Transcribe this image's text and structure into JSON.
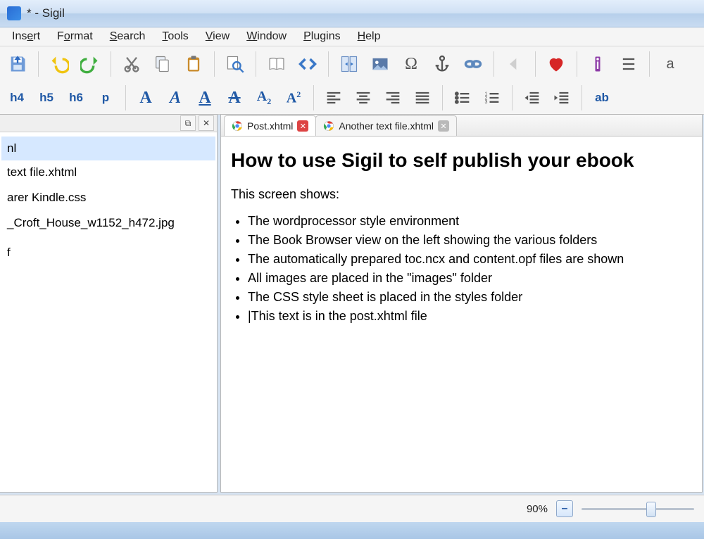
{
  "window": {
    "title": "* - Sigil"
  },
  "menu": {
    "insert": {
      "label": "Insert",
      "u": 4
    },
    "format": {
      "label": "Format",
      "u": 1
    },
    "search": {
      "label": "Search",
      "u": 0
    },
    "tools": {
      "label": "Tools",
      "u": 0
    },
    "view": {
      "label": "View",
      "u": 0
    },
    "window": {
      "label": "Window",
      "u": 0
    },
    "plugins": {
      "label": "Plugins",
      "u": 0
    },
    "help": {
      "label": "Help",
      "u": 0
    }
  },
  "toolbar1": {
    "save": "save-icon",
    "undo": "undo-icon",
    "redo": "redo-icon",
    "cut": "cut-icon",
    "copy": "copy-icon",
    "paste": "paste-icon",
    "find": "find-icon",
    "bookview": "book-icon",
    "codeview": "code-icon",
    "split": "split-icon",
    "insert_image": "image-icon",
    "special_char": "omega-icon",
    "anchor": "anchor-icon",
    "link": "link-icon",
    "back": "back-icon",
    "favorite": "heart-icon",
    "metadata": "info-icon",
    "toc": "toc-icon"
  },
  "toolbar2": {
    "headings": [
      "h4",
      "h5",
      "h6",
      "p"
    ],
    "bold": "A",
    "italic": "A",
    "underline": "A",
    "strike": "A",
    "subscript": "A2",
    "superscript": "A2",
    "align": [
      "left",
      "center",
      "right",
      "justify"
    ],
    "lists": [
      "ul",
      "ol"
    ],
    "indent": [
      "outdent",
      "indent"
    ],
    "case": "ab"
  },
  "pane": {
    "dock": "⧉",
    "close": "✕",
    "items": [
      {
        "label": "nl",
        "sel": true
      },
      {
        "label": "text file.xhtml",
        "sel": false
      },
      {
        "label": "",
        "sel": false
      },
      {
        "label": "arer Kindle.css",
        "sel": false
      },
      {
        "label": "",
        "sel": false
      },
      {
        "label": "_Croft_House_w1152_h472.jpg",
        "sel": false
      },
      {
        "label": "",
        "sel": false
      },
      {
        "label": "",
        "sel": false
      },
      {
        "label": "",
        "sel": false
      },
      {
        "label": "",
        "sel": false
      },
      {
        "label": "f",
        "sel": false
      }
    ]
  },
  "tabs": [
    {
      "label": "Post.xhtml",
      "active": true
    },
    {
      "label": "Another text file.xhtml",
      "active": false
    }
  ],
  "doc": {
    "h1": "How to use Sigil to self publish your ebook",
    "p": "This screen shows:",
    "bullets": [
      "The wordprocessor style environment",
      "The Book Browser view on the left showing the various folders",
      "The automatically prepared toc.ncx and content.opf files are shown",
      "All images are placed in the \"images\" folder",
      "The CSS style sheet is placed in the styles folder",
      "|This text is in the post.xhtml file"
    ]
  },
  "status": {
    "zoom": "90%",
    "minus": "–",
    "plus": "+"
  }
}
